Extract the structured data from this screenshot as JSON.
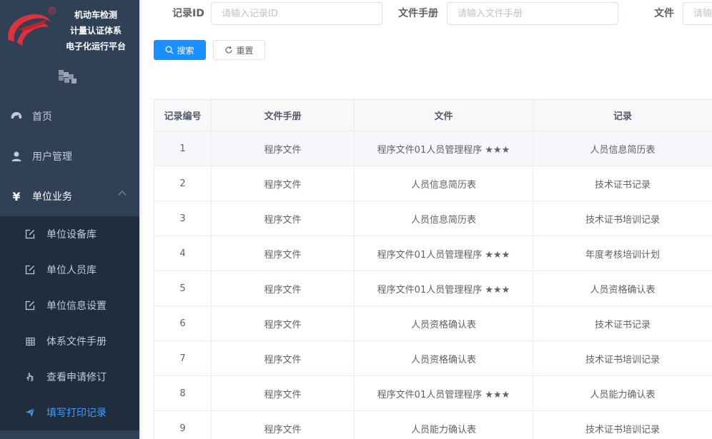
{
  "logo": {
    "lines": [
      "机动车检测",
      "计量认证体系",
      "电子化运行平台"
    ],
    "registered_mark": "®"
  },
  "colors": {
    "sidebar_bg": "#304156",
    "submenu_bg": "#1f2d3d",
    "active": "#409eff",
    "primary": "#1890ff"
  },
  "sidebar": {
    "items": [
      {
        "label": "首页",
        "icon": "dashboard-icon"
      },
      {
        "label": "用户管理",
        "icon": "user-icon"
      },
      {
        "label": "单位业务",
        "icon": "yen-icon"
      }
    ],
    "subitems": [
      {
        "label": "单位设备库",
        "icon": "edit-icon"
      },
      {
        "label": "单位人员库",
        "icon": "edit-icon"
      },
      {
        "label": "单位信息设置",
        "icon": "edit-icon"
      },
      {
        "label": "体系文件手册",
        "icon": "grid-icon"
      },
      {
        "label": "查看申请修订",
        "icon": "hand-icon"
      },
      {
        "label": "填写打印记录",
        "icon": "send-icon"
      }
    ]
  },
  "filters": {
    "record_id_label": "记录ID",
    "record_id_placeholder": "请输入记录ID",
    "manual_label": "文件手册",
    "manual_placeholder": "请输入文件手册",
    "file_label": "文件",
    "file_placeholder": "请输"
  },
  "buttons": {
    "search": "搜索",
    "reset": "重置"
  },
  "table": {
    "headers": [
      "记录编号",
      "文件手册",
      "文件",
      "记录"
    ],
    "rows": [
      [
        "1",
        "程序文件",
        "程序文件01人员管理程序 ★★★",
        "人员信息简历表"
      ],
      [
        "2",
        "程序文件",
        "人员信息简历表",
        "技术证书记录"
      ],
      [
        "3",
        "程序文件",
        "人员信息简历表",
        "技术证书培训记录"
      ],
      [
        "4",
        "程序文件",
        "程序文件01人员管理程序 ★★★",
        "年度考核培训计划"
      ],
      [
        "5",
        "程序文件",
        "程序文件01人员管理程序 ★★★",
        "人员资格确认表"
      ],
      [
        "6",
        "程序文件",
        "人员资格确认表",
        "技术证书记录"
      ],
      [
        "7",
        "程序文件",
        "人员资格确认表",
        "技术证书培训记录"
      ],
      [
        "8",
        "程序文件",
        "程序文件01人员管理程序 ★★★",
        "人员能力确认表"
      ],
      [
        "9",
        "程序文件",
        "人员能力确认表",
        "技术证书培训记录"
      ]
    ]
  }
}
